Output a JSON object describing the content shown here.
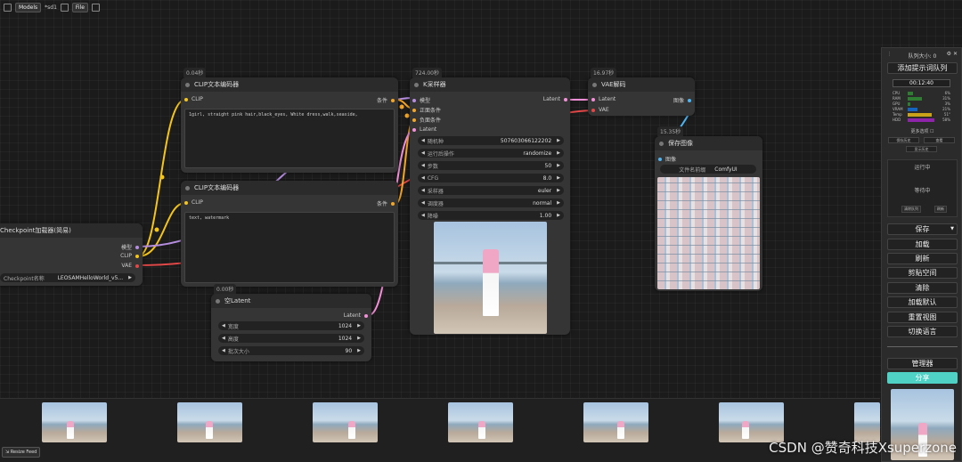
{
  "topbar": {
    "models": "Models",
    "workflow": "*sd1",
    "file": "File"
  },
  "nodes": {
    "clip1": {
      "time": "0.04秒",
      "title": "CLIP文本编码器",
      "in_clip": "CLIP",
      "out": "条件",
      "text": "1girl, straight pink hair,black_eyes, White dress,walk,seaside,"
    },
    "clip2": {
      "title": "CLIP文本编码器",
      "in_clip": "CLIP",
      "out": "条件",
      "text": "text, watermark"
    },
    "ckpt": {
      "title": "Checkpoint加载器(简易)",
      "out_model": "模型",
      "out_clip": "CLIP",
      "out_vae": "VAE",
      "name_label": "Checkpoint名称",
      "name_value": "LEOSAMHelloWorld_v5..."
    },
    "latent": {
      "time": "0.00秒",
      "title": "空Latent",
      "out": "Latent",
      "w_label": "宽度",
      "w": "1024",
      "h_label": "高度",
      "h": "1024",
      "b_label": "批次大小",
      "b": "90"
    },
    "ksampler": {
      "time": "724.00秒",
      "title": "K采样器",
      "in_model": "模型",
      "in_pos": "正面条件",
      "in_neg": "负面条件",
      "in_latent": "Latent",
      "out": "Latent",
      "widgets": [
        {
          "label": "随机种",
          "value": "507603066122202"
        },
        {
          "label": "运行后操作",
          "value": "randomize"
        },
        {
          "label": "步数",
          "value": "50"
        },
        {
          "label": "CFG",
          "value": "8.0"
        },
        {
          "label": "采样器",
          "value": "euler"
        },
        {
          "label": "调度器",
          "value": "normal"
        },
        {
          "label": "降噪",
          "value": "1.00"
        }
      ]
    },
    "vae": {
      "time": "16.97秒",
      "title": "VAE解码",
      "in_latent": "Latent",
      "in_vae": "VAE",
      "out": "图像"
    },
    "save": {
      "time": "15.35秒",
      "title": "保存图像",
      "in_img": "图像",
      "prefix_label": "文件名前缀",
      "prefix_value": "ComfyUI"
    }
  },
  "side": {
    "queue": "队列大小: 0",
    "add_queue": "添加提示词队列",
    "timer": "00:12:40",
    "stats": [
      {
        "label": "CPU",
        "value": "6%",
        "color": "#2e7d32"
      },
      {
        "label": "RAM",
        "value": "31%",
        "color": "#2e7d32"
      },
      {
        "label": "GPU",
        "value": "3%",
        "color": "#2e7d32"
      },
      {
        "label": "VRAM",
        "value": "21%",
        "color": "#1565c0"
      },
      {
        "label": "Temp",
        "value": "51°",
        "color": "#c9a21a"
      },
      {
        "label": "HDD",
        "value": "58%",
        "color": "#8e24aa"
      }
    ],
    "more": "更多选项",
    "small1": "保存历史",
    "small2": "查看",
    "small3": "显示历史",
    "running": "运行中",
    "pending": "等待中",
    "clear_queue": "清除队列",
    "refresh_small": "刷新",
    "btns": [
      "保存",
      "加载",
      "刷新",
      "剪贴空间",
      "清除",
      "加载默认",
      "重置视图",
      "切换语言"
    ],
    "manager": "管理器",
    "share": "分享"
  },
  "feed": {
    "resize": "Resize Feed"
  },
  "watermark": "CSDN @赞奇科技Xsuperzone"
}
